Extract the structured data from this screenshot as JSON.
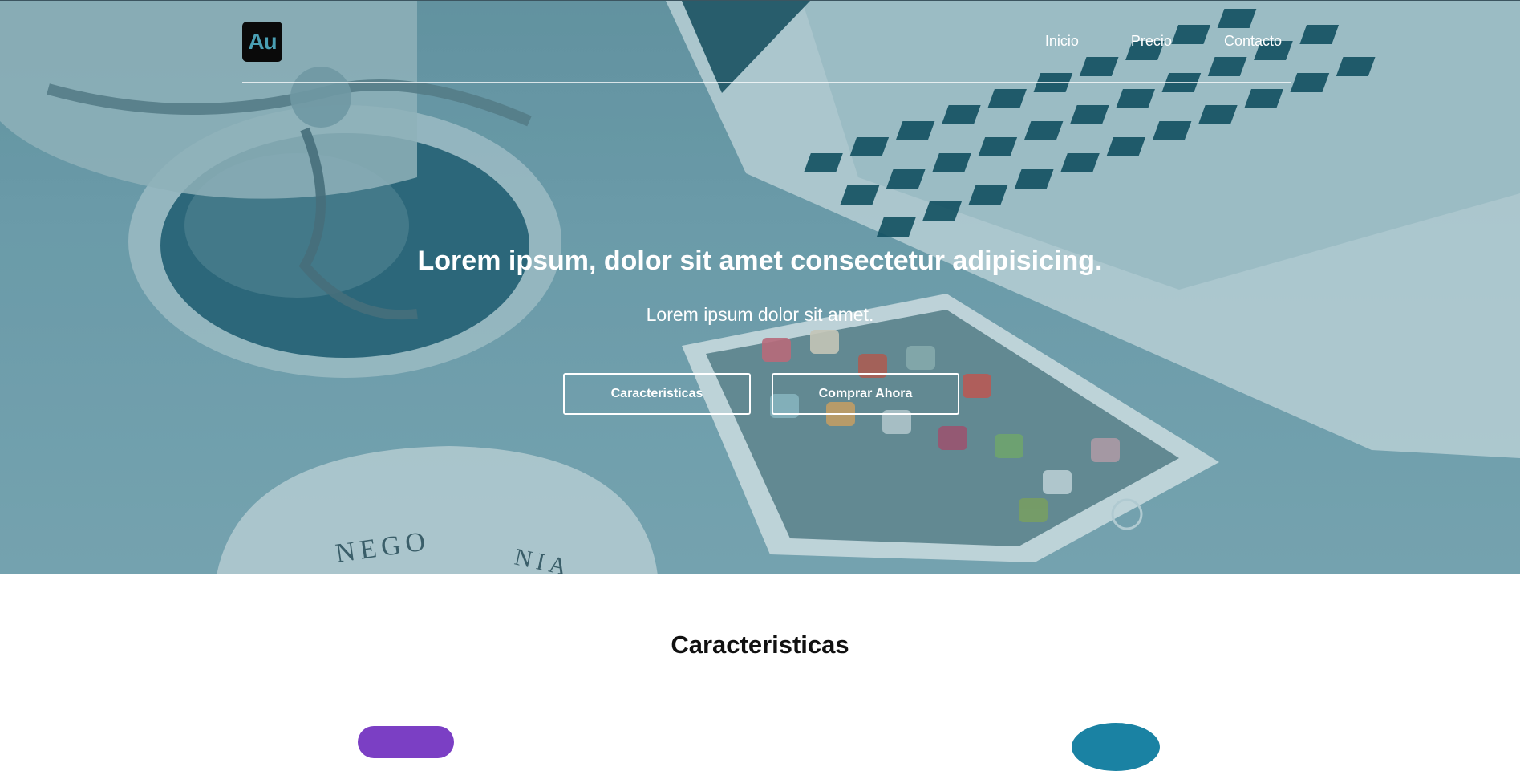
{
  "header": {
    "logo_text": "Au",
    "nav": [
      {
        "label": "Inicio"
      },
      {
        "label": "Precio"
      },
      {
        "label": "Contacto"
      }
    ]
  },
  "hero": {
    "title": "Lorem ipsum, dolor sit amet consectetur adipisicing.",
    "subtitle": "Lorem ipsum dolor sit amet.",
    "buttons": {
      "features_label": "Caracteristicas",
      "buy_label": "Comprar Ahora"
    }
  },
  "features": {
    "title": "Caracteristicas"
  },
  "colors": {
    "hero_tint": "#2a8aa3",
    "logo_bg": "#0a0a0a",
    "logo_text": "#4a9fb3",
    "accent_purple": "#7b3fc4",
    "accent_teal": "#1a82a3"
  }
}
